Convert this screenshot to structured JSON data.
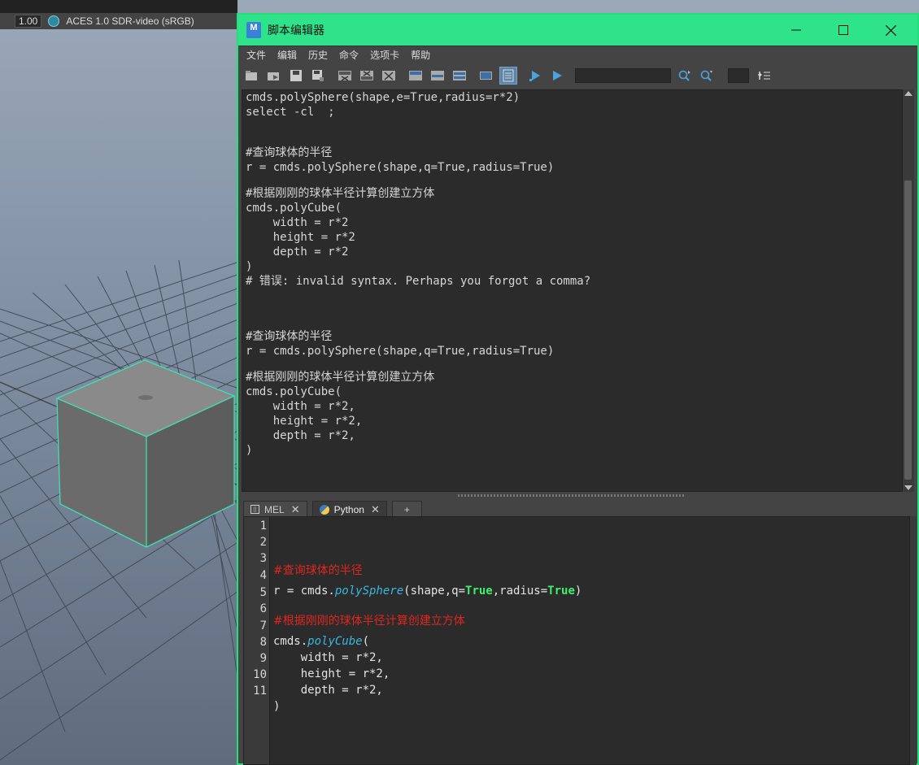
{
  "viewport": {
    "exposure": "1.00",
    "color_space": "ACES 1.0 SDR-video (sRGB)"
  },
  "window": {
    "title": "脚本编辑器",
    "app_icon_label": "M",
    "accent_color": "#2fe38a"
  },
  "menu": [
    "文件",
    "编辑",
    "历史",
    "命令",
    "选项卡",
    "帮助"
  ],
  "toolbar_icons": [
    "open-script-icon",
    "source-script-icon",
    "save-script-icon",
    "save-script-to-shelf-icon",
    "clear-history-icon",
    "clear-input-icon",
    "clear-all-icon",
    "echo-all-commands-icon",
    "show-line-numbers-icon",
    "history-only-icon",
    "show-stack-trace-icon",
    "history-input-icon",
    "execute-all-icon",
    "execute-icon",
    "search-forward-icon",
    "search-back-icon",
    "goto-line-icon"
  ],
  "history": {
    "lines": [
      "cmds.polySphere(shape,e=True,radius=r*2)",
      "select -cl  ;",
      "",
      "#查询球体的半径",
      "r = cmds.polySphere(shape,q=True,radius=True)",
      "",
      "#根据刚刚的球体半径计算创建立方体",
      "cmds.polyCube(",
      "    width = r*2",
      "    height = r*2",
      "    depth = r*2",
      ")",
      "# 错误: invalid syntax. Perhaps you forgot a comma?",
      "",
      "",
      "#查询球体的半径",
      "r = cmds.polySphere(shape,q=True,radius=True)",
      "",
      "#根据刚刚的球体半径计算创建立方体",
      "cmds.polyCube(",
      "    width = r*2,",
      "    height = r*2,",
      "    depth = r*2,",
      ")"
    ]
  },
  "tabs": [
    {
      "label": "MEL",
      "close": "✕"
    },
    {
      "label": "Python",
      "close": "✕"
    },
    {
      "label": "+"
    }
  ],
  "editor": {
    "line_numbers": [
      "1",
      "2",
      "3",
      "4",
      "5",
      "6",
      "7",
      "8",
      "9",
      "10",
      "11"
    ],
    "comment1": "#查询球体的半径",
    "l4_a": "r = cmds.",
    "l4_fn": "polySphere",
    "l4_b": "(shape,q=",
    "l4_kw1": "True",
    "l4_c": ",radius=",
    "l4_kw2": "True",
    "l4_d": ")",
    "comment2": "#根据刚刚的球体半径计算创建立方体",
    "l7_a": "cmds.",
    "l7_fn": "polyCube",
    "l7_b": "(",
    "l8": "    width = r*2,",
    "l9": "    height = r*2,",
    "l10": "    depth = r*2,",
    "l11": ")"
  }
}
